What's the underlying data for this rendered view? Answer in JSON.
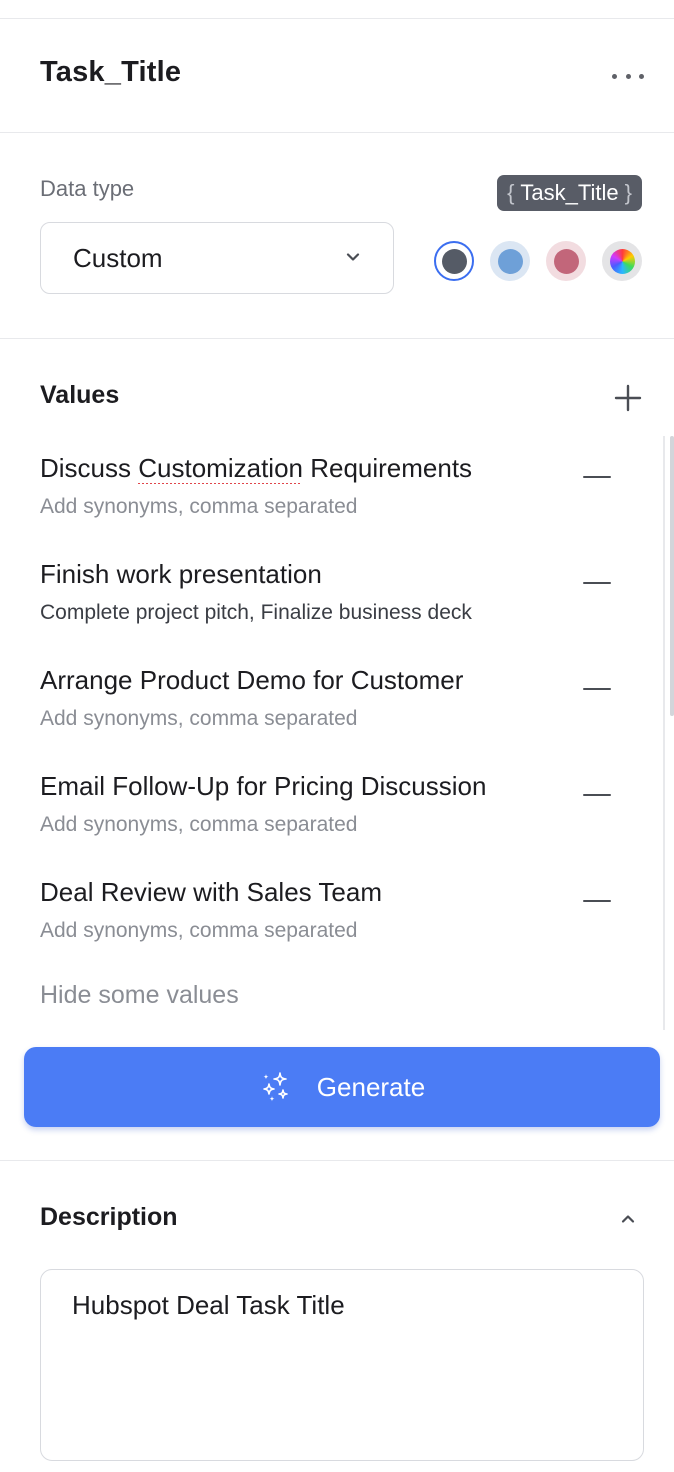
{
  "header": {
    "title": "Task_Title"
  },
  "data_type": {
    "label": "Data type",
    "selected": "Custom",
    "variable_chip": "Task_Title",
    "brace_open": "{",
    "brace_close": "}",
    "colors": [
      "#555b66",
      "#6ea0d8",
      "#c2667a",
      "multicolor"
    ],
    "selected_color": "#555b66"
  },
  "values": {
    "heading": "Values",
    "items": [
      {
        "name_before": "Discuss ",
        "name_flagged": "Customization",
        "name_after": " Requirements",
        "synonyms": "Add synonyms, comma separated"
      },
      {
        "name": "Finish work presentation",
        "synonyms": "Complete project pitch, Finalize business deck"
      },
      {
        "name": "Arrange Product Demo for Customer",
        "synonyms": "Add synonyms, comma separated"
      },
      {
        "name": "Email Follow-Up for Pricing Discussion",
        "synonyms": "Add synonyms, comma separated"
      },
      {
        "name": "Deal Review with Sales Team",
        "synonyms": "Add synonyms, comma separated"
      }
    ],
    "hide_label": "Hide some values"
  },
  "generate": {
    "label": "Generate"
  },
  "description": {
    "heading": "Description",
    "value": "Hubspot Deal Task Title"
  },
  "theme": {
    "accent": "#4b7cf5",
    "chip_bg": "#585c66"
  }
}
